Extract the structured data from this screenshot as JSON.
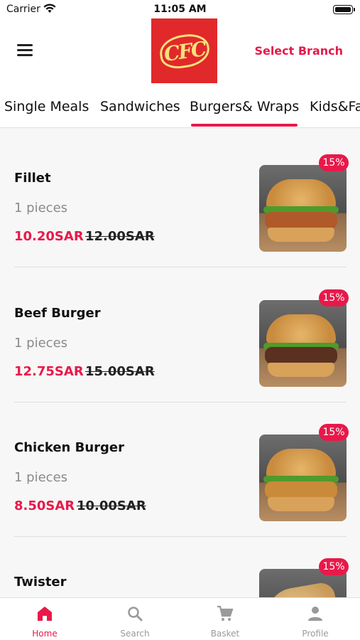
{
  "status_bar": {
    "carrier": "Carrier",
    "time": "11:05 AM"
  },
  "header": {
    "select_branch": "Select Branch",
    "logo_text": "CFC"
  },
  "tabs": [
    {
      "label": "Single Meals"
    },
    {
      "label": "Sandwiches"
    },
    {
      "label": "Burgers& Wraps",
      "active": true
    },
    {
      "label": "Kids&Fa"
    }
  ],
  "items": [
    {
      "name": "Fillet",
      "pieces": "1 pieces",
      "price": "10.20SAR",
      "old_price": "12.00SAR",
      "discount": "15%"
    },
    {
      "name": "Beef Burger",
      "pieces": "1 pieces",
      "price": "12.75SAR",
      "old_price": "15.00SAR",
      "discount": "15%"
    },
    {
      "name": "Chicken Burger",
      "pieces": "1 pieces",
      "price": "8.50SAR",
      "old_price": "10.00SAR",
      "discount": "15%"
    },
    {
      "name": "Twister",
      "pieces": "",
      "price": "",
      "old_price": "",
      "discount": "15%"
    }
  ],
  "nav": [
    {
      "label": "Home",
      "icon": "home-icon",
      "active": true
    },
    {
      "label": "Search",
      "icon": "search-icon"
    },
    {
      "label": "Basket",
      "icon": "cart-icon"
    },
    {
      "label": "Profile",
      "icon": "profile-icon"
    }
  ],
  "colors": {
    "accent": "#e8194a",
    "logo_red": "#e1292b",
    "logo_yellow": "#f6e27a"
  }
}
